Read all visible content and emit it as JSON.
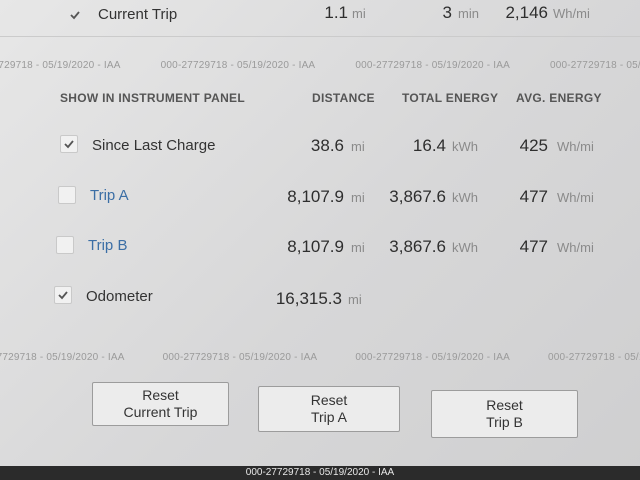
{
  "current_trip": {
    "label": "Current Trip",
    "distance": "1.1",
    "distance_unit": "mi",
    "time": "3",
    "time_unit": "min",
    "energy": "2,146",
    "energy_unit": "Wh/mi"
  },
  "watermark_text": "000-27729718 - 05/19/2020 - IAA",
  "headers": {
    "show": "SHOW IN INSTRUMENT PANEL",
    "distance": "DISTANCE",
    "total_energy": "TOTAL ENERGY",
    "avg_energy": "AVG. ENERGY"
  },
  "rows": [
    {
      "label": "Since Last Charge",
      "checked": true,
      "distance": "38.6",
      "distance_unit": "mi",
      "energy": "16.4",
      "energy_unit": "kWh",
      "avg": "425",
      "avg_unit": "Wh/mi"
    },
    {
      "label": "Trip A",
      "checked": false,
      "distance": "8,107.9",
      "distance_unit": "mi",
      "energy": "3,867.6",
      "energy_unit": "kWh",
      "avg": "477",
      "avg_unit": "Wh/mi"
    },
    {
      "label": "Trip B",
      "checked": false,
      "distance": "8,107.9",
      "distance_unit": "mi",
      "energy": "3,867.6",
      "energy_unit": "kWh",
      "avg": "477",
      "avg_unit": "Wh/mi"
    },
    {
      "label": "Odometer",
      "checked": true,
      "distance": "16,315.3",
      "distance_unit": "mi"
    }
  ],
  "buttons": {
    "reset_current_trip": "Reset\nCurrent Trip",
    "reset_trip_a": "Reset\nTrip A",
    "reset_trip_b": "Reset\nTrip B"
  },
  "footer_text": "000-27729718 - 05/19/2020 - IAA",
  "icons": {
    "checkbox": "check-icon"
  }
}
